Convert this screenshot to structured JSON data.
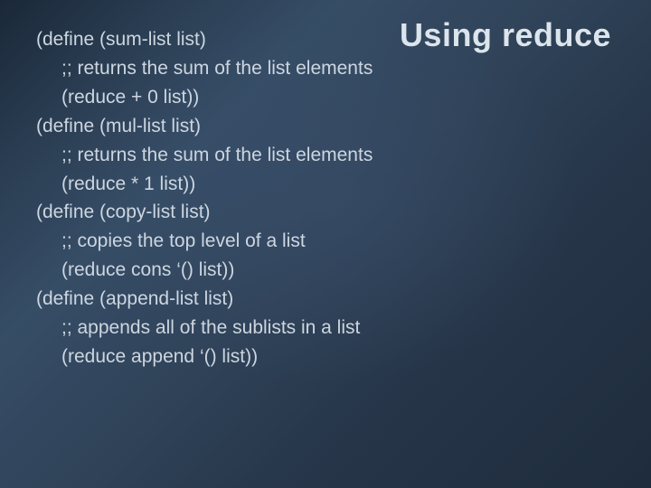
{
  "title": "Using reduce",
  "code": {
    "lines": [
      {
        "indent": 0,
        "text": "(define (sum-list list)"
      },
      {
        "indent": 1,
        "text": ";; returns the sum of the list elements"
      },
      {
        "indent": 1,
        "text": "(reduce + 0 list))"
      },
      {
        "indent": 0,
        "text": "(define (mul-list list)"
      },
      {
        "indent": 1,
        "text": ";; returns the sum of the list elements"
      },
      {
        "indent": 1,
        "text": "(reduce * 1 list))"
      },
      {
        "indent": 0,
        "text": "(define (copy-list list)"
      },
      {
        "indent": 1,
        "text": ";; copies the top level of a list"
      },
      {
        "indent": 1,
        "text": "(reduce cons ‘() list))"
      },
      {
        "indent": 0,
        "text": "(define (append-list list)"
      },
      {
        "indent": 1,
        "text": ";; appends all of the sublists in a list"
      },
      {
        "indent": 1,
        "text": "(reduce append ‘() list))"
      }
    ]
  }
}
